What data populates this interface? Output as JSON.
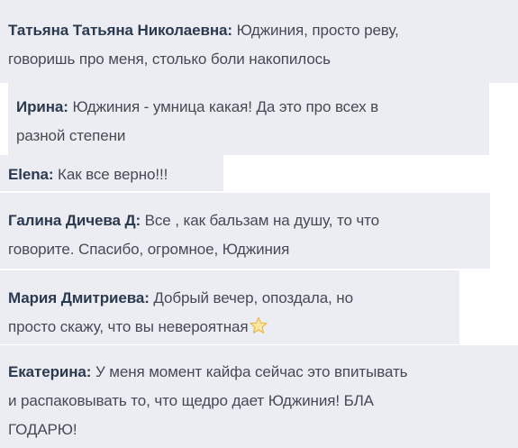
{
  "messages": [
    {
      "author": "Татьяна Татьяна Николаевна:",
      "line1": "Юджиния, просто реву,",
      "line2": "говоришь про меня, столько боли накопилось"
    },
    {
      "author": "Ирина:",
      "line1": "Юджиния - умница какая! Да это про всех в",
      "line2": "разной степени"
    },
    {
      "author": "Elena:",
      "line1": "Как все верно!!!"
    },
    {
      "author": "Галина Дичева Д:",
      "line1": "Все , как бальзам на душу, то что",
      "line2": "говорите. Спасибо, огромное, Юджиния"
    },
    {
      "author": "Мария Дмитриева:",
      "line1": "Добрый вечер, опоздала, но",
      "line2": "просто скажу, что вы невероятная",
      "emoji": "star-emoji-icon"
    },
    {
      "author": "Екатерина:",
      "line1": "У меня момент кайфа сейчас это впитывать",
      "line2": "и распаковывать то, что щедро дает Юджиния! БЛА",
      "line3": "ГОДАРЮ!"
    }
  ],
  "colors": {
    "bubble_background": "#ebedf2",
    "author_name": "#2c3a4f",
    "message_text": "#454a55",
    "star_fill": "#fbe6a2",
    "star_stroke": "#e8b54a"
  }
}
